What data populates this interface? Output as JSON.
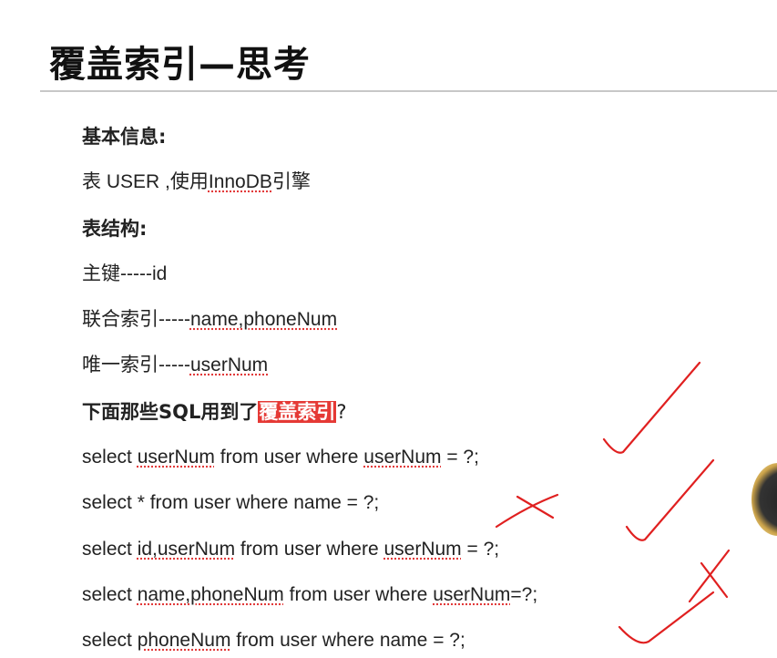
{
  "slide": {
    "title": "覆盖索引—思考",
    "basic_info_heading": "基本信息:",
    "table_line_prefix": "表 USER ,使用",
    "table_engine": "InnoDB",
    "table_line_suffix": "引擎",
    "structure_heading": "表结构:",
    "primary_key": {
      "label": "主键-----",
      "value": "id"
    },
    "composite_index": {
      "label": "联合索引-----",
      "value": "name,phoneNum"
    },
    "unique_index": {
      "label": "唯一索引-----",
      "value": "userNum"
    },
    "question": {
      "prefix": "下面那些SQL用到了",
      "highlight": "覆盖索引",
      "suffix": "?"
    },
    "queries": [
      {
        "p1": "select ",
        "u1": "userNum",
        "p2": " from user where ",
        "u2": "userNum",
        "p3": " = ?;"
      },
      {
        "p1": "select * from user where name = ?;",
        "u1": "",
        "p2": "",
        "u2": "",
        "p3": ""
      },
      {
        "p1": "select ",
        "u1": "id,userNum",
        "p2": " from user where ",
        "u2": "userNum",
        "p3": " = ?;"
      },
      {
        "p1": "select ",
        "u1": "name,phoneNum",
        "p2": " from user where ",
        "u2": "userNum",
        "p3": "=?;"
      },
      {
        "p1": "select ",
        "u1": "phoneNum",
        "p2": " from user where name = ?;",
        "u2": "",
        "p3": ""
      }
    ]
  },
  "annotations": {
    "ink_color": "#e02020",
    "marks": [
      "check",
      "cross",
      "check",
      "cross",
      "check"
    ]
  }
}
